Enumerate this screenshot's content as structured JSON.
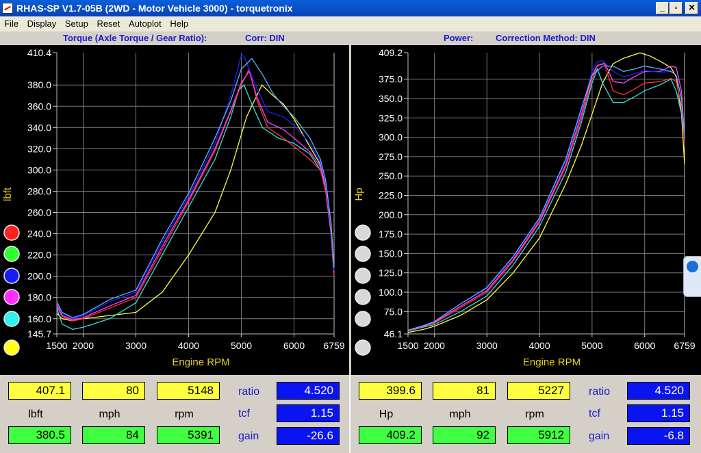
{
  "window": {
    "title": "RHAS-SP V1.7-05B   (2WD - Motor Vehicle 3000) - torquetronix"
  },
  "menu": [
    "File",
    "Display",
    "Setup",
    "Reset",
    "Autoplot",
    "Help"
  ],
  "swatch_colors": [
    "#ff2020",
    "#30ff30",
    "#1a1aff",
    "#ff30ff",
    "#30f0f0",
    "#ffff20"
  ],
  "chart_data": [
    {
      "type": "line",
      "title": "Torque (Axle Torque / Gear Ratio):",
      "subtitle": "Corr: DIN",
      "xlabel": "Engine RPM",
      "ylabel": "lbft",
      "xlim": [
        1500,
        6759
      ],
      "ylim": [
        145.7,
        410.4
      ],
      "x_ticks": [
        1500,
        2000,
        3000,
        4000,
        5000,
        6000,
        6759
      ],
      "y_ticks": [
        145.7,
        160.0,
        180.0,
        200.0,
        220.0,
        240.0,
        260.0,
        280.0,
        300.0,
        320.0,
        340.0,
        360.0,
        380.0,
        410.4
      ],
      "grid": true,
      "series": [
        {
          "color": "#ffff40",
          "x": [
            1500,
            1600,
            1800,
            2000,
            2500,
            3000,
            3500,
            4000,
            4500,
            4800,
            5100,
            5391,
            5600,
            5800,
            6000,
            6300,
            6500,
            6600,
            6700,
            6759
          ],
          "y": [
            165,
            160,
            158,
            160,
            163,
            166,
            185,
            220,
            260,
            300,
            350,
            380,
            370,
            362,
            348,
            322,
            305,
            285,
            250,
            205
          ]
        },
        {
          "color": "#30e0e0",
          "x": [
            1500,
            1600,
            1800,
            2000,
            2500,
            3000,
            3500,
            4000,
            4500,
            4800,
            4950,
            5050,
            5200,
            5400,
            5700,
            6000,
            6300,
            6500,
            6600,
            6700,
            6759
          ],
          "y": [
            170,
            155,
            150,
            152,
            160,
            175,
            220,
            265,
            310,
            350,
            375,
            380,
            362,
            340,
            330,
            325,
            315,
            300,
            280,
            240,
            200
          ]
        },
        {
          "color": "#ff3030",
          "x": [
            1500,
            1600,
            1800,
            2000,
            2500,
            3000,
            3500,
            4000,
            4500,
            4800,
            5000,
            5148,
            5300,
            5500,
            5800,
            6000,
            6300,
            6500,
            6600,
            6700,
            6759
          ],
          "y": [
            172,
            162,
            158,
            160,
            170,
            180,
            225,
            270,
            318,
            355,
            380,
            395,
            365,
            340,
            330,
            322,
            310,
            300,
            280,
            240,
            200
          ]
        },
        {
          "color": "#ff40ff",
          "x": [
            1500,
            1600,
            1800,
            2000,
            2500,
            3000,
            3500,
            4000,
            4500,
            4800,
            5000,
            5150,
            5300,
            5500,
            5800,
            6000,
            6300,
            6500,
            6600,
            6700,
            6759
          ],
          "y": [
            173,
            163,
            159,
            161,
            172,
            182,
            228,
            272,
            320,
            356,
            382,
            393,
            368,
            345,
            338,
            330,
            317,
            303,
            283,
            243,
            203
          ]
        },
        {
          "color": "#2020ff",
          "x": [
            1500,
            1600,
            1800,
            2000,
            2500,
            3000,
            3500,
            4000,
            4500,
            4800,
            5000,
            5050,
            5250,
            5500,
            5800,
            6000,
            6300,
            6500,
            6600,
            6700,
            6759
          ],
          "y": [
            175,
            165,
            160,
            163,
            176,
            185,
            232,
            275,
            325,
            370,
            408,
            407,
            382,
            355,
            350,
            342,
            325,
            307,
            287,
            247,
            205
          ]
        },
        {
          "color": "#60b0ff",
          "x": [
            1500,
            1600,
            1800,
            2000,
            2500,
            3000,
            3500,
            4000,
            4500,
            4800,
            5000,
            5200,
            5400,
            5600,
            5800,
            6000,
            6300,
            6500,
            6600,
            6700,
            6759
          ],
          "y": [
            176,
            166,
            161,
            164,
            178,
            187,
            235,
            278,
            330,
            365,
            395,
            405,
            390,
            372,
            360,
            350,
            330,
            310,
            290,
            250,
            208
          ]
        }
      ],
      "readout": {
        "torque_1": "407.1",
        "speed_1": "80",
        "rpm_1": "5148",
        "unit_labels": [
          "lbft",
          "mph",
          "rpm"
        ],
        "torque_2": "380.5",
        "speed_2": "84",
        "rpm_2": "5391",
        "ratio_label": "ratio",
        "ratio": "4.520",
        "tcf_label": "tcf",
        "tcf": "1.15",
        "gain_label": "gain",
        "gain": "-26.6"
      }
    },
    {
      "type": "line",
      "title": "Power:",
      "subtitle": "Correction Method: DIN",
      "xlabel": "Engine RPM",
      "ylabel": "Hp",
      "xlim": [
        1500,
        6759
      ],
      "ylim": [
        46.1,
        409.2
      ],
      "x_ticks": [
        1500,
        2000,
        3000,
        4000,
        5000,
        6000,
        6759
      ],
      "y_ticks": [
        46.1,
        75.0,
        100.0,
        125.0,
        150.0,
        175.0,
        200.0,
        225.0,
        250.0,
        275.0,
        300.0,
        325.0,
        350.0,
        375.0,
        409.2
      ],
      "grid": true,
      "series": [
        {
          "color": "#ffff40",
          "x": [
            1500,
            1800,
            2000,
            2500,
            3000,
            3500,
            4000,
            4500,
            4800,
            5000,
            5200,
            5400,
            5600,
            5912,
            6100,
            6300,
            6500,
            6600,
            6700,
            6759
          ],
          "y": [
            48,
            52,
            56,
            70,
            90,
            125,
            170,
            240,
            290,
            330,
            370,
            395,
            402,
            409,
            405,
            398,
            390,
            378,
            330,
            265
          ]
        },
        {
          "color": "#30e0e0",
          "x": [
            1500,
            1800,
            2000,
            2500,
            3000,
            3500,
            4000,
            4500,
            4800,
            5000,
            5100,
            5200,
            5400,
            5600,
            5800,
            6000,
            6300,
            6500,
            6600,
            6700,
            6759
          ],
          "y": [
            50,
            55,
            58,
            75,
            95,
            135,
            185,
            255,
            320,
            370,
            388,
            370,
            345,
            345,
            352,
            360,
            368,
            375,
            360,
            330,
            300
          ]
        },
        {
          "color": "#ff3030",
          "x": [
            1500,
            1800,
            2000,
            2500,
            3000,
            3500,
            4000,
            4500,
            4800,
            5000,
            5100,
            5227,
            5400,
            5600,
            5800,
            6000,
            6300,
            6500,
            6600,
            6700,
            6759
          ],
          "y": [
            50,
            56,
            60,
            80,
            100,
            140,
            190,
            262,
            325,
            375,
            392,
            396,
            360,
            355,
            362,
            370,
            372,
            376,
            372,
            340,
            290
          ]
        },
        {
          "color": "#ff40ff",
          "x": [
            1500,
            1800,
            2000,
            2500,
            3000,
            3500,
            4000,
            4500,
            4800,
            5000,
            5100,
            5250,
            5400,
            5600,
            5800,
            6000,
            6300,
            6500,
            6600,
            6700,
            6759
          ],
          "y": [
            50,
            56,
            61,
            82,
            102,
            142,
            192,
            265,
            330,
            380,
            393,
            395,
            372,
            370,
            378,
            385,
            385,
            392,
            390,
            360,
            300
          ]
        },
        {
          "color": "#2020ff",
          "x": [
            1500,
            1800,
            2000,
            2500,
            3000,
            3500,
            4000,
            4500,
            4800,
            5000,
            5100,
            5200,
            5400,
            5600,
            5800,
            6000,
            6300,
            6500,
            6600,
            6700,
            6759
          ],
          "y": [
            51,
            57,
            62,
            85,
            105,
            145,
            195,
            270,
            335,
            385,
            398,
            399,
            385,
            378,
            382,
            386,
            384,
            385,
            380,
            350,
            300
          ]
        },
        {
          "color": "#60b0ff",
          "x": [
            1500,
            1800,
            2000,
            2500,
            3000,
            3500,
            4000,
            4500,
            4800,
            5000,
            5200,
            5400,
            5600,
            5800,
            6000,
            6300,
            6500,
            6600,
            6700,
            6759
          ],
          "y": [
            51,
            57,
            62,
            85,
            106,
            146,
            196,
            272,
            338,
            380,
            392,
            392,
            385,
            388,
            392,
            388,
            385,
            380,
            350,
            300
          ]
        }
      ],
      "readout": {
        "power_1": "399.6",
        "speed_1": "81",
        "rpm_1": "5227",
        "unit_labels": [
          "Hp",
          "mph",
          "rpm"
        ],
        "power_2": "409.2",
        "speed_2": "92",
        "rpm_2": "5912",
        "ratio_label": "ratio",
        "ratio": "4.520",
        "tcf_label": "tcf",
        "tcf": "1.15",
        "gain_label": "gain",
        "gain": "-6.8"
      }
    }
  ]
}
